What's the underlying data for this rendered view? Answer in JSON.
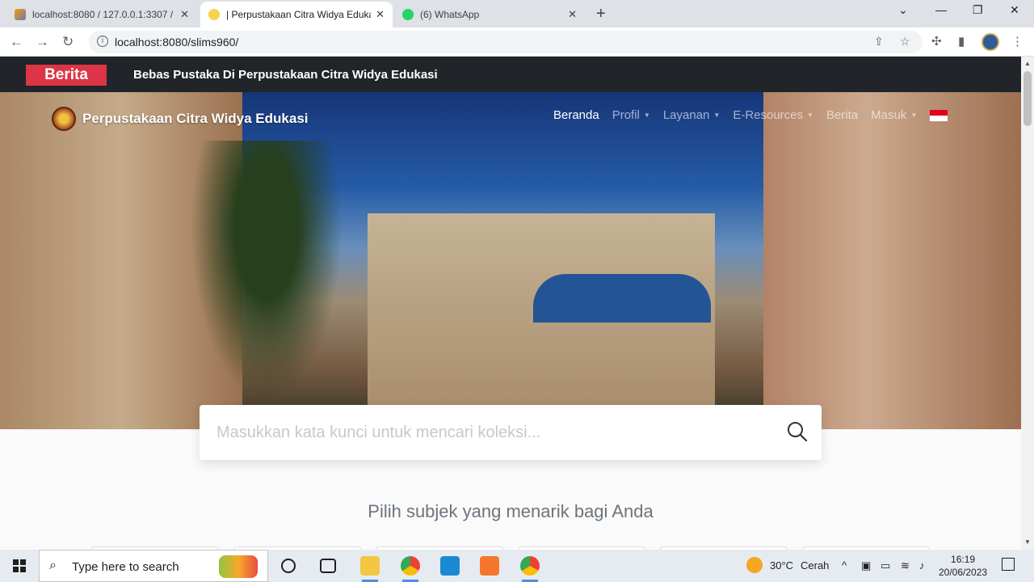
{
  "browser": {
    "tabs": [
      {
        "title": "localhost:8080 / 127.0.0.1:3307 /",
        "active": false
      },
      {
        "title": "| Perpustakaan Citra Widya Edukasi",
        "active": true
      },
      {
        "title": "(6) WhatsApp",
        "active": false
      }
    ],
    "url": "localhost:8080/slims960/"
  },
  "page": {
    "news_badge": "Berita",
    "news_text": "Bebas Pustaka Di Perpustakaan Citra Widya Edukasi",
    "site_name": "Perpustakaan Citra Widya Edukasi",
    "nav": [
      {
        "label": "Beranda",
        "dropdown": false,
        "active": true
      },
      {
        "label": "Profil",
        "dropdown": true,
        "active": false
      },
      {
        "label": "Layanan",
        "dropdown": true,
        "active": false
      },
      {
        "label": "E-Resources",
        "dropdown": true,
        "active": false
      },
      {
        "label": "Berita",
        "dropdown": false,
        "active": false
      },
      {
        "label": "Masuk",
        "dropdown": true,
        "active": false
      }
    ],
    "search_placeholder": "Masukkan kata kunci untuk mencari koleksi...",
    "subject_heading": "Pilih subjek yang menarik bagi Anda"
  },
  "taskbar": {
    "search_text": "Type here to search",
    "weather_temp": "30°C",
    "weather_text": "Cerah",
    "time": "16:19",
    "date": "20/06/2023"
  },
  "colors": {
    "news_badge": "#dc3545",
    "news_bar": "#212529"
  }
}
